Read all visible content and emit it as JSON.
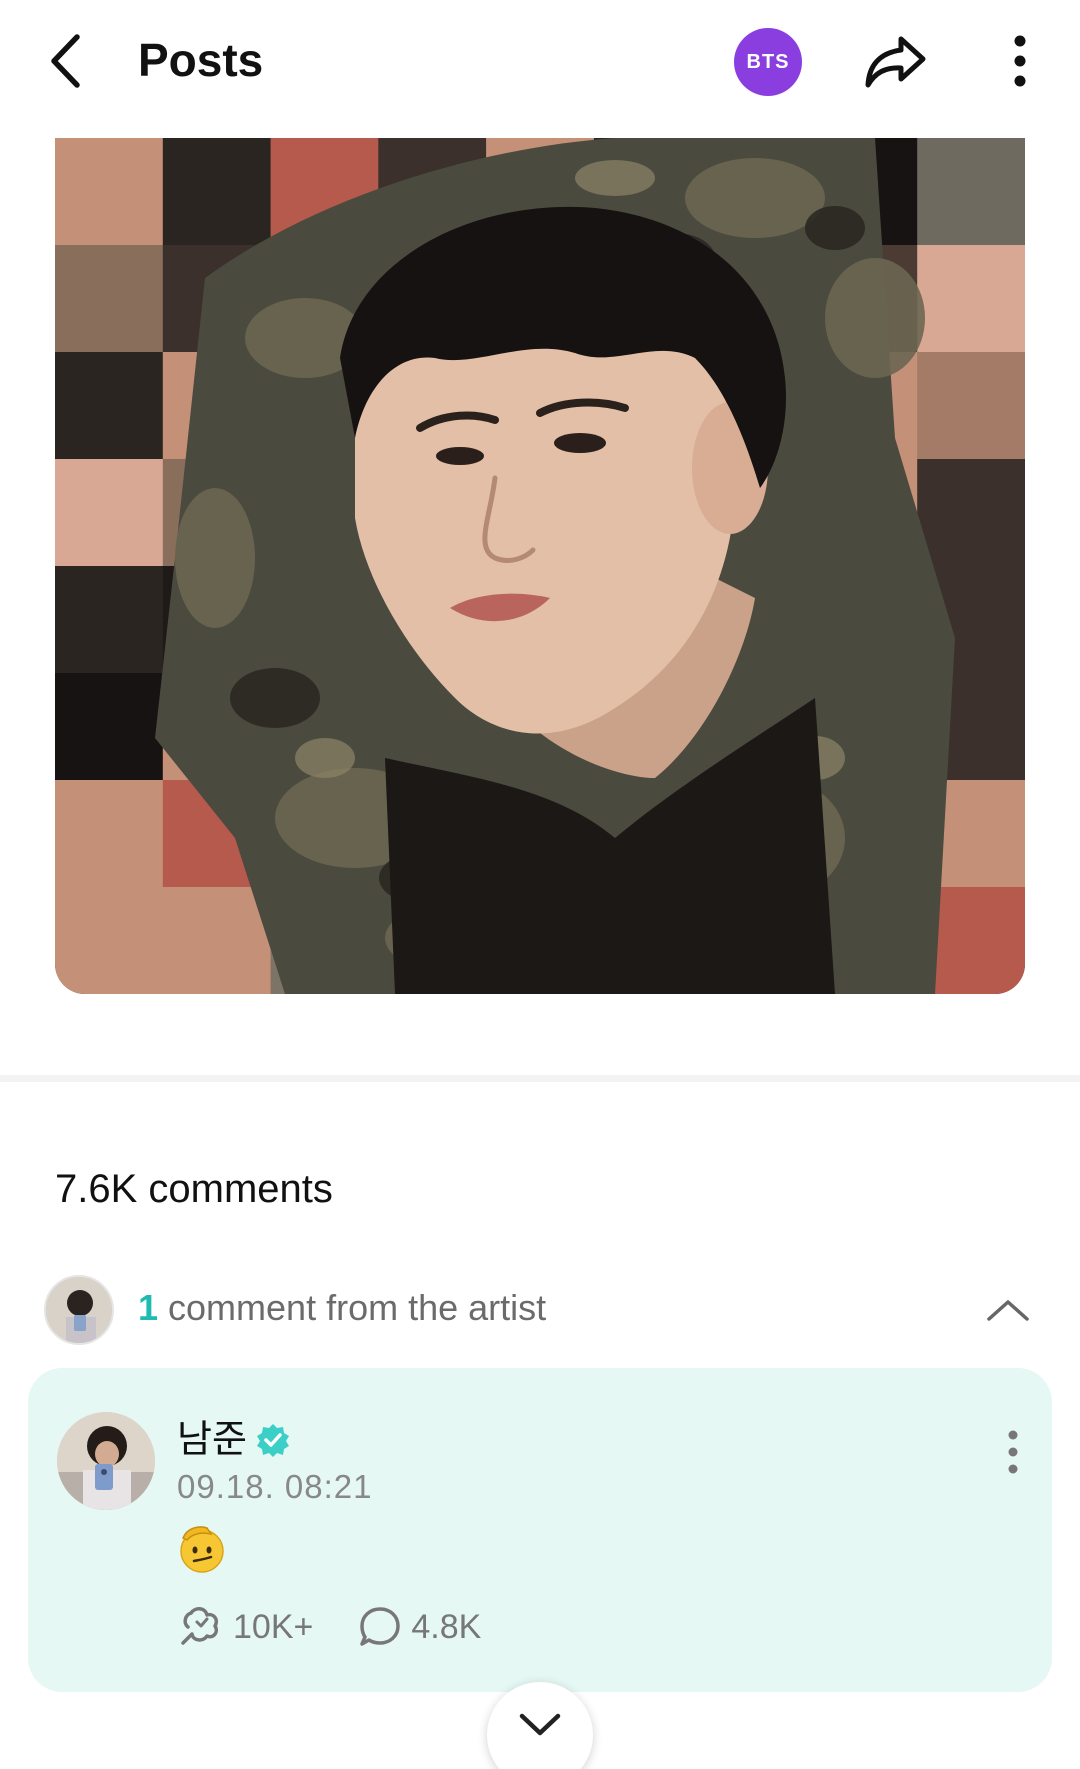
{
  "header": {
    "title": "Posts",
    "artist_badge": "BTS"
  },
  "post": {
    "image_alt": "Photo of a person in a camouflage uniform against a pixelated mosaic background"
  },
  "comments": {
    "count_label": "7.6K comments"
  },
  "artist_comments": {
    "count": "1",
    "summary": "comment from the artist"
  },
  "comment": {
    "author": "남준",
    "timestamp": "09.18. 08:21",
    "content_emoji": "saluting-face",
    "likes": "10K+",
    "replies": "4.8K"
  },
  "colors": {
    "brand_purple": "#8a3ee0",
    "accent_teal": "#1fbab0",
    "card_bg": "#e6f8f4",
    "verified": "#3ccfc7"
  },
  "icons": {
    "back": "chevron-left-icon",
    "share": "share-arrow-icon",
    "more": "more-vertical-icon",
    "collapse": "chevron-up-icon",
    "verified": "verified-badge-icon",
    "like": "lightstick-heart-icon",
    "reply": "speech-bubble-icon",
    "scroll": "chevron-down-icon"
  }
}
